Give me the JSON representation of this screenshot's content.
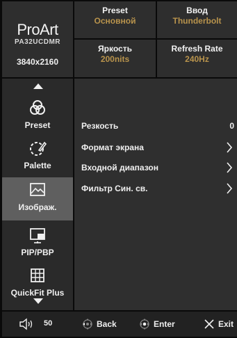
{
  "brand": {
    "logo": "ProArt",
    "model": "PA32UCDMR",
    "resolution": "3840x2160"
  },
  "info": [
    {
      "label": "Preset",
      "value": "Основной"
    },
    {
      "label": "Ввод",
      "value": "Thunderbolt"
    },
    {
      "label": "Яркость",
      "value": "200nits"
    },
    {
      "label": "Refresh Rate",
      "value": "240Hz"
    }
  ],
  "sidebar": {
    "items": [
      {
        "label": "Preset",
        "icon": "preset-icon"
      },
      {
        "label": "Palette",
        "icon": "palette-icon"
      },
      {
        "label": "Изображ.",
        "icon": "image-icon",
        "active": true
      },
      {
        "label": "PIP/PBP",
        "icon": "pip-pbp-icon"
      },
      {
        "label": "QuickFit Plus",
        "icon": "quickfit-grid-icon"
      }
    ]
  },
  "menu": {
    "rows": [
      {
        "label": "Резкость",
        "value": "0"
      },
      {
        "label": "Формат экрана"
      },
      {
        "label": "Входной диапазон"
      },
      {
        "label": "Фильтр Син. св."
      }
    ]
  },
  "footer": {
    "volume": "50",
    "back": "Back",
    "enter": "Enter",
    "exit": "Exit"
  },
  "colors": {
    "accent": "#b8934c",
    "active_bg": "#5f5f5f",
    "panel_bg": "#2f2f2f"
  }
}
